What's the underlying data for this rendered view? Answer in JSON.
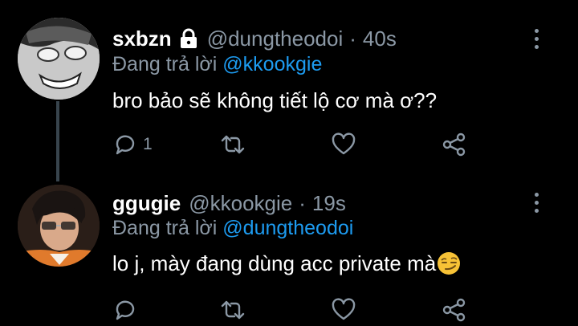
{
  "tweets": [
    {
      "display_name": "sxbzn",
      "handle": "@dungtheodoi",
      "time": "40s",
      "reply_prefix": "Đang trả lời",
      "reply_to": "@kkookgie",
      "text": "bro bảo sẽ không tiết lộ cơ mà ơ??",
      "reply_count": "1",
      "protected": true
    },
    {
      "display_name": "ggugie",
      "handle": "@kkookgie",
      "time": "19s",
      "reply_prefix": "Đang trả lời",
      "reply_to": "@dungtheodoi",
      "text": "lo j, mày đang dùng acc private mà",
      "reply_count": "",
      "protected": false
    }
  ],
  "separator": "·",
  "colors": {
    "background": "#000000",
    "secondary_text": "#8b98a5",
    "mention": "#1d9bf0",
    "thread_line": "#38444d"
  },
  "icons": {
    "lock": "lock-icon",
    "reply": "reply-icon",
    "retweet": "retweet-icon",
    "like": "heart-icon",
    "share": "share-icon",
    "more": "more-vertical-icon",
    "emoji": "smirking-face-emoji"
  }
}
